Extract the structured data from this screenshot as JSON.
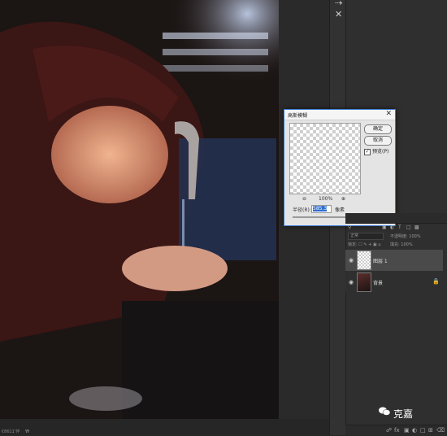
{
  "canvas": {
    "status_text": "€8611‘怀 　₩"
  },
  "toolstrip": {
    "icon_top": "collapse-icon",
    "icon_close": "close-icon"
  },
  "dialog": {
    "title": "高斯模糊",
    "close_glyph": "✕",
    "ok_label": "确定",
    "cancel_label": "取消",
    "preview_label": "预览(P)",
    "preview_checked": true,
    "zoom_value": "100%",
    "radius_label": "半径(R):",
    "radius_value": "585.3",
    "radius_unit": "像素"
  },
  "layers": {
    "blend_mode": "正常",
    "opacity_label": "不透明度: 100%",
    "lock_label": "锁定: ☐ ✎ ✛ ▣ ⌂",
    "fill_label": "填充: 100%",
    "items": [
      {
        "name": "图层 1",
        "visible": true,
        "selected": true
      },
      {
        "name": "背景",
        "visible": true,
        "selected": false,
        "locked": true
      }
    ]
  },
  "watermark": {
    "text": "克嘉"
  }
}
